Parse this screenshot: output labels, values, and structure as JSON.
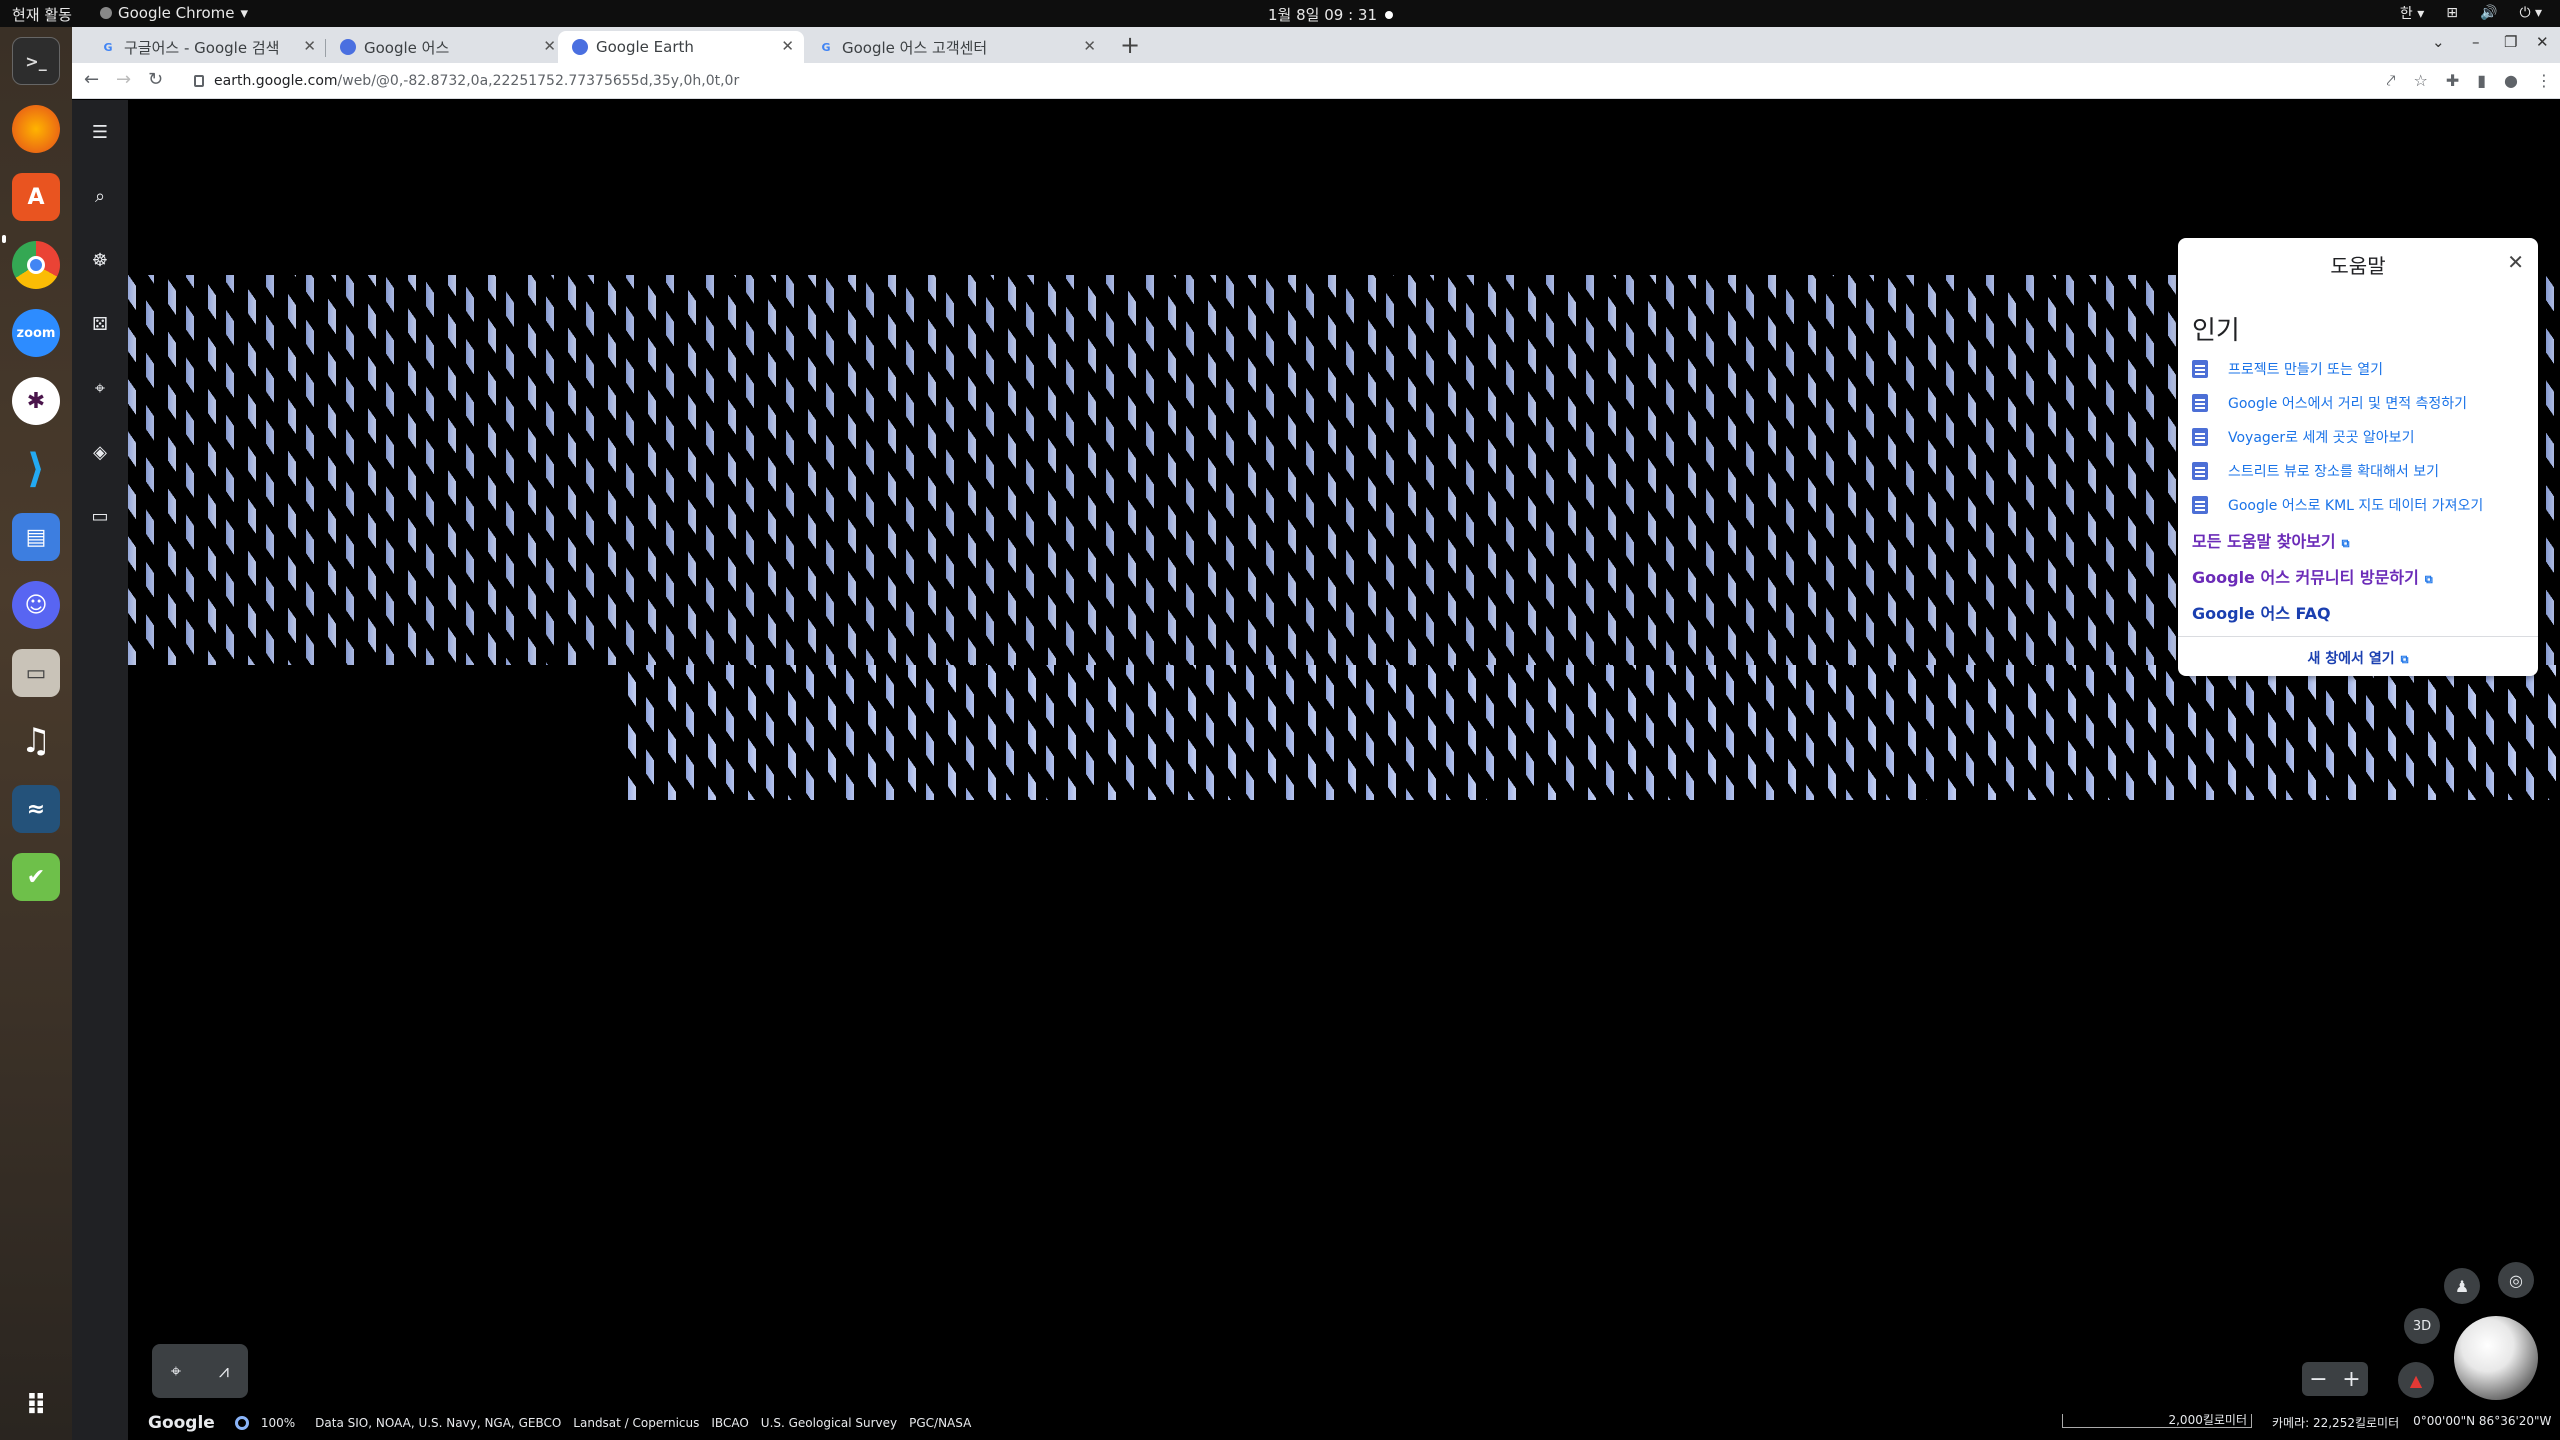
{
  "topbar": {
    "activities": "현재 활동",
    "app_name": "Google Chrome",
    "datetime": "1월 8일 09 : 31",
    "input_method": "한"
  },
  "tabs": [
    {
      "title": "구글어스 - Google 검색",
      "active": false
    },
    {
      "title": "Google 어스",
      "active": false
    },
    {
      "title": "Google Earth",
      "active": true
    },
    {
      "title": "Google 어스 고객센터",
      "active": false
    }
  ],
  "address": {
    "host": "earth.google.com",
    "path": "/web/@0,-82.8732,0a,22251752.77375655d,35y,0h,0t,0r"
  },
  "help": {
    "title": "도움말",
    "section": "인기",
    "articles": [
      "프로젝트 만들기 또는 열기",
      "Google 어스에서 거리 및 면적 측정하기",
      "Voyager로 세계 곳곳 알아보기",
      "스트리트 뷰로 장소를 확대해서 보기",
      "Google 어스로 KML 지도 데이터 가져오기"
    ],
    "link_all_help": "모든 도움말 찾아보기",
    "link_community": "Google 어스 커뮤니티 방문하기",
    "link_faq": "Google 어스 FAQ",
    "open_new_window": "새 창에서 열기"
  },
  "footer": {
    "google": "Google",
    "zoom": "100%",
    "attributions": [
      "Data SIO, NOAA, U.S. Navy, NGA, GEBCO",
      "Landsat / Copernicus",
      "IBCAO",
      "U.S. Geological Survey",
      "PGC/NASA"
    ],
    "scale": "2,000킬로미터",
    "camera": "카메라: 22,252킬로미터",
    "coordinates": "0°00'00\"N 86°36'20\"W"
  },
  "map_controls": {
    "mode_3d": "3D"
  }
}
